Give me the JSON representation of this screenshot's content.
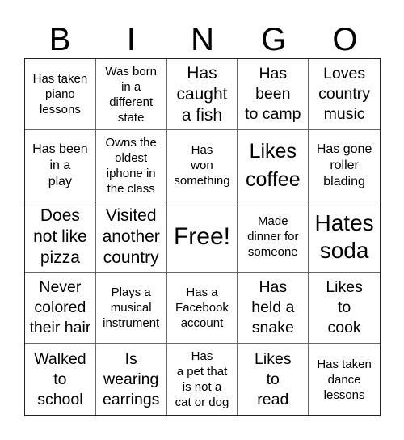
{
  "header": {
    "letters": [
      "B",
      "I",
      "N",
      "G",
      "O"
    ]
  },
  "card": {
    "rows": [
      [
        {
          "text": "Has taken\npiano\nlessons"
        },
        {
          "text": "Was born\nin a\ndifferent\nstate"
        },
        {
          "text": "Has\ncaught\na fish"
        },
        {
          "text": "Has\nbeen\nto camp"
        },
        {
          "text": "Loves\ncountry\nmusic"
        }
      ],
      [
        {
          "text": "Has been\nin a\nplay"
        },
        {
          "text": "Owns the\noldest\niphone in\nthe class"
        },
        {
          "text": "Has\nwon\nsomething"
        },
        {
          "text": "Likes\ncoffee"
        },
        {
          "text": "Has gone\nroller\nblading"
        }
      ],
      [
        {
          "text": "Does\nnot like\npizza"
        },
        {
          "text": "Visited\nanother\ncountry"
        },
        {
          "text": "Free!"
        },
        {
          "text": "Made\ndinner for\nsomeone"
        },
        {
          "text": "Hates\nsoda"
        }
      ],
      [
        {
          "text": "Never\ncolored\ntheir hair"
        },
        {
          "text": "Plays a\nmusical\ninstrument"
        },
        {
          "text": "Has a\nFacebook\naccount"
        },
        {
          "text": "Has\nheld a\nsnake"
        },
        {
          "text": "Likes\nto\ncook"
        }
      ],
      [
        {
          "text": "Walked\nto\nschool"
        },
        {
          "text": "Is\nwearing\nearrings"
        },
        {
          "text": "Has\na pet that\nis not a\ncat or dog"
        },
        {
          "text": "Likes\nto\nread"
        },
        {
          "text": "Has taken\ndance\nlessons"
        }
      ]
    ]
  },
  "colors": {
    "border_outer": "#222222",
    "border_inner": "#666666",
    "text": "#000000",
    "background": "#ffffff"
  }
}
